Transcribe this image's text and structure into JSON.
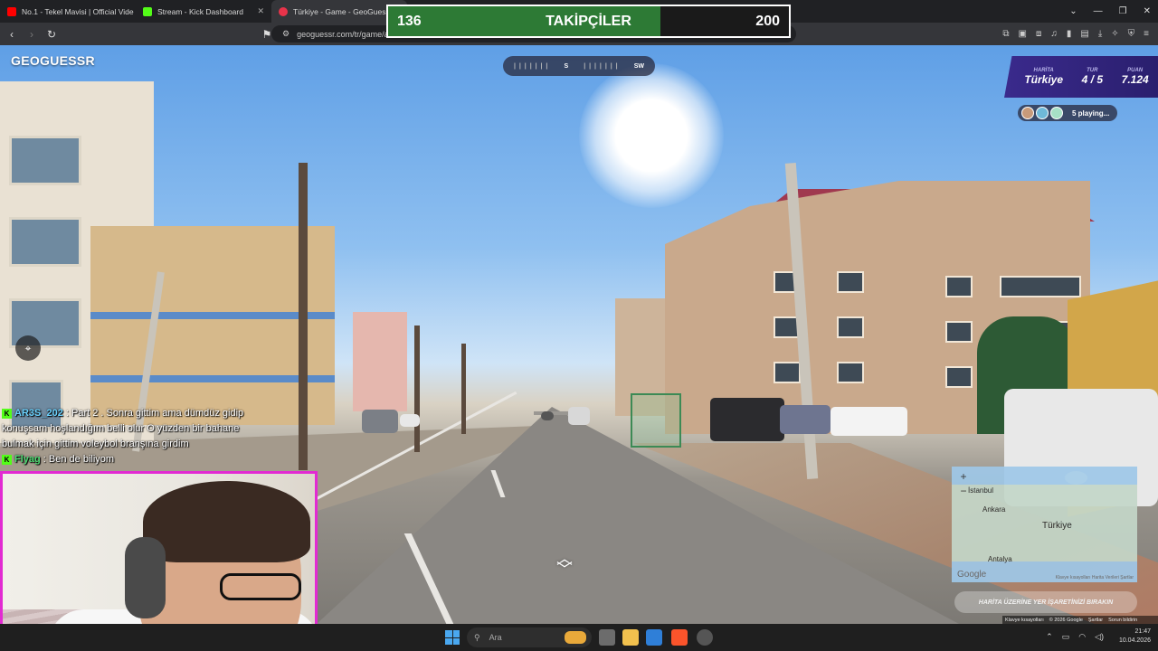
{
  "browser": {
    "tabs": [
      {
        "label": "No.1 - Tekel Mavisi | Official Vide",
        "color": "#ff0000"
      },
      {
        "label": "Stream - Kick Dashboard",
        "color": "#53fc18"
      },
      {
        "label": "Türkiye - Game - GeoGuessr",
        "color": "#e8334a"
      }
    ],
    "url": "geoguessr.com/tr/game/a"
  },
  "followers_goal": {
    "current": "136",
    "title": "TAKİPÇİLER",
    "target": "200",
    "progress": 0.68
  },
  "game": {
    "logo": "GEOGUESSR",
    "compass": {
      "s": "S",
      "sw": "SW"
    },
    "panel": {
      "map_label": "HARİTA",
      "map_value": "Türkiye",
      "round_label": "TUR",
      "round_value": "4 / 5",
      "score_label": "PUAN",
      "score_value": "7.124"
    },
    "playing": "5 playing...",
    "guess_button": "HARİTA ÜZERİNE YER İŞARETİNİZİ BIRAKIN",
    "map": {
      "istanbul": "İstanbul",
      "ankara": "Ankara",
      "turkiye": "Türkiye",
      "antalya": "Antalya",
      "google": "Google",
      "credits": "Klavye kısayolları   Harita Verileri   Şartlar"
    },
    "bottom_credits": [
      "Klavye kısayolları",
      "© 2026 Google",
      "Şartlar",
      "Sorun bildirin"
    ]
  },
  "chat": [
    {
      "user": "AR3S_202",
      "message": ": Part 2 . Sonra gittim ama dümdüz gidip konuşsam hoşlandığım belli olur O yüzden bir bahane bulmak için gittim voleybol branşına girdim"
    },
    {
      "user": "Flyag",
      "message": ": Ben de biliyom"
    }
  ],
  "taskbar": {
    "search_placeholder": "Ara",
    "time": "21:47",
    "date": "10.04.2026"
  }
}
